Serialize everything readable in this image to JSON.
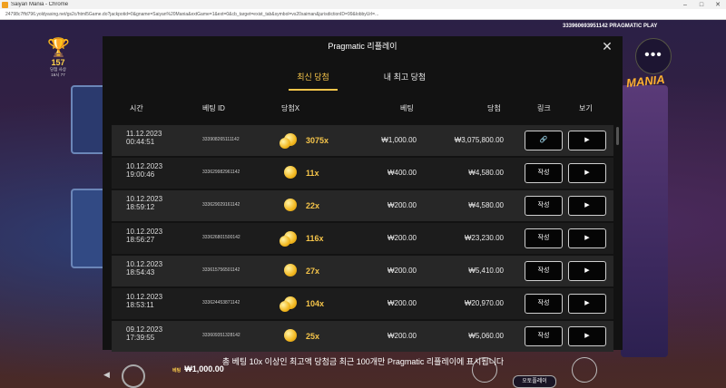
{
  "browser": {
    "title": "Saiyan Mania - Chrome",
    "url": "24798c7ffd796.yoldyasing.net/gs2c/html5Game.do?jackpotid=0&gname=Saiyan%20Mania&extGame=1&ext=0&cb_target=exist_tab&symbol=vs20saiman&jurisdictionID=99&lobbyUrl=..."
  },
  "game": {
    "trophy_count": "157",
    "trophy_label_1": "당첨 사상",
    "trophy_label_2": "16시 77",
    "top_id": "333960693951142",
    "top_brand": "PRAGMATIC PLAY",
    "logo": "MANIA",
    "menu_icon": "dots-icon",
    "info_text": "총 베팅 10x 이상인 최고액 당첨금 최근 100개만 Pragmatic 리플레이에 표시됩니다",
    "bet_label": "베팅",
    "bet_value": "₩1,000.00",
    "autoplay": "오토플레이"
  },
  "modal": {
    "title": "Pragmatic 리플레이",
    "close_icon": "close-icon",
    "tabs": [
      {
        "label": "최신 당첨",
        "active": true
      },
      {
        "label": "내 최고 당첨",
        "active": false
      }
    ],
    "columns": {
      "time": "시간",
      "bet_id": "베팅 ID",
      "win_x": "당첨X",
      "bet": "베팅",
      "win": "당첨",
      "link": "링크",
      "view": "보기"
    },
    "link_button_label": "작성",
    "rows": [
      {
        "date": "11.12.2023",
        "time": "00:44:51",
        "bet_id": "333908265111142",
        "mult": "3075x",
        "bet": "₩1,000.00",
        "win": "₩3,075,800.00",
        "link": "🔗"
      },
      {
        "date": "10.12.2023",
        "time": "19:00:46",
        "bet_id": "333629982961142",
        "mult": "11x",
        "bet": "₩400.00",
        "win": "₩4,580.00",
        "link": "작성"
      },
      {
        "date": "10.12.2023",
        "time": "18:59:12",
        "bet_id": "333629029161142",
        "mult": "22x",
        "bet": "₩200.00",
        "win": "₩4,580.00",
        "link": "작성"
      },
      {
        "date": "10.12.2023",
        "time": "18:56:27",
        "bet_id": "333626801500142",
        "mult": "116x",
        "bet": "₩200.00",
        "win": "₩23,230.00",
        "link": "작성"
      },
      {
        "date": "10.12.2023",
        "time": "18:54:43",
        "bet_id": "333615756501142",
        "mult": "27x",
        "bet": "₩200.00",
        "win": "₩5,410.00",
        "link": "작성"
      },
      {
        "date": "10.12.2023",
        "time": "18:53:11",
        "bet_id": "333624453871142",
        "mult": "104x",
        "bet": "₩200.00",
        "win": "₩20,970.00",
        "link": "작성"
      },
      {
        "date": "09.12.2023",
        "time": "17:39:55",
        "bet_id": "333609351328142",
        "mult": "25x",
        "bet": "₩200.00",
        "win": "₩5,060.00",
        "link": "작성"
      }
    ],
    "play_icon": "play-icon",
    "accent_color": "#f6c54a"
  }
}
